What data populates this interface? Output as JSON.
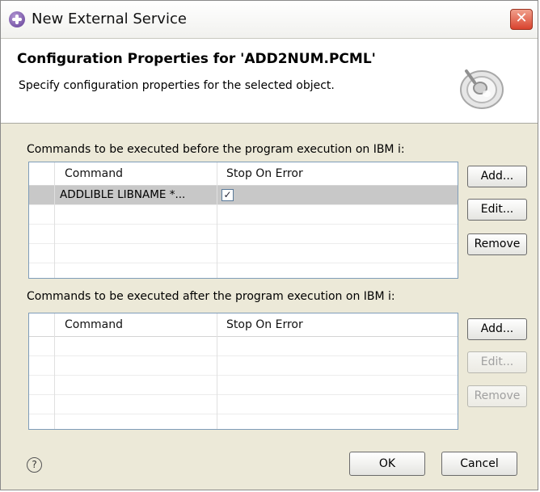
{
  "window": {
    "title": "New External Service",
    "close_symbol": "✕"
  },
  "header": {
    "title": "Configuration Properties for 'ADD2NUM.PCML'",
    "description": "Specify configuration properties for the selected object."
  },
  "before_section": {
    "label": "Commands to be executed before the program execution on IBM i:",
    "columns": [
      "Command",
      "Stop On Error"
    ],
    "rows": [
      {
        "command": "ADDLIBLE LIBNAME *...",
        "stop_on_error": true
      }
    ],
    "buttons": {
      "add": "Add...",
      "edit": "Edit...",
      "remove": "Remove"
    }
  },
  "after_section": {
    "label": "Commands to be executed after the program execution on IBM i:",
    "columns": [
      "Command",
      "Stop On Error"
    ],
    "rows": [],
    "buttons": {
      "add": "Add...",
      "edit": "Edit...",
      "remove": "Remove"
    }
  },
  "footer": {
    "help_symbol": "?",
    "ok_label": "OK",
    "cancel_label": "Cancel"
  },
  "colors": {
    "selection": "#c8c8c8",
    "dialog_bg": "#ece9d8",
    "close_red": "#d9432e"
  }
}
